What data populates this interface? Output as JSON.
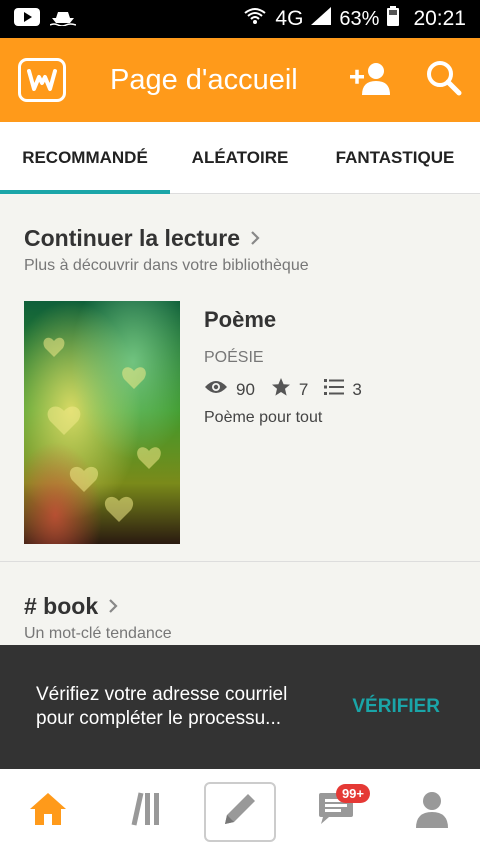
{
  "status_bar": {
    "network": "4G",
    "battery": "63%",
    "time": "20:21",
    "icons": [
      "youtube-icon",
      "boat-icon",
      "wifi-icon",
      "signal-icon",
      "battery-icon"
    ]
  },
  "app_bar": {
    "title": "Page d'accueil",
    "logo_icon": "wattpad-logo-icon",
    "actions": [
      "add-person-icon",
      "search-icon"
    ]
  },
  "tabs": [
    {
      "label": "RECOMMANDÉ",
      "active": true
    },
    {
      "label": "ALÉATOIRE",
      "active": false
    },
    {
      "label": "FANTASTIQUE",
      "active": false
    }
  ],
  "continue_reading": {
    "title": "Continuer la lecture",
    "subtitle": "Plus à découvrir dans votre bibliothèque",
    "story": {
      "title": "Poème",
      "genre": "POÉSIE",
      "reads": "90",
      "votes": "7",
      "parts": "3",
      "description": "Poème pour tout"
    }
  },
  "tag_section": {
    "title": "# book",
    "subtitle": "Un mot-clé tendance"
  },
  "snackbar": {
    "message": "Vérifiez votre adresse courriel pour compléter le processu...",
    "action": "VÉRIFIER"
  },
  "bottom_nav": {
    "items": [
      "home-icon",
      "library-icon",
      "write-icon",
      "messages-icon",
      "profile-icon"
    ],
    "messages_badge": "99+"
  },
  "colors": {
    "brand": "#ff9a1a",
    "accent": "#1aa5a8"
  }
}
